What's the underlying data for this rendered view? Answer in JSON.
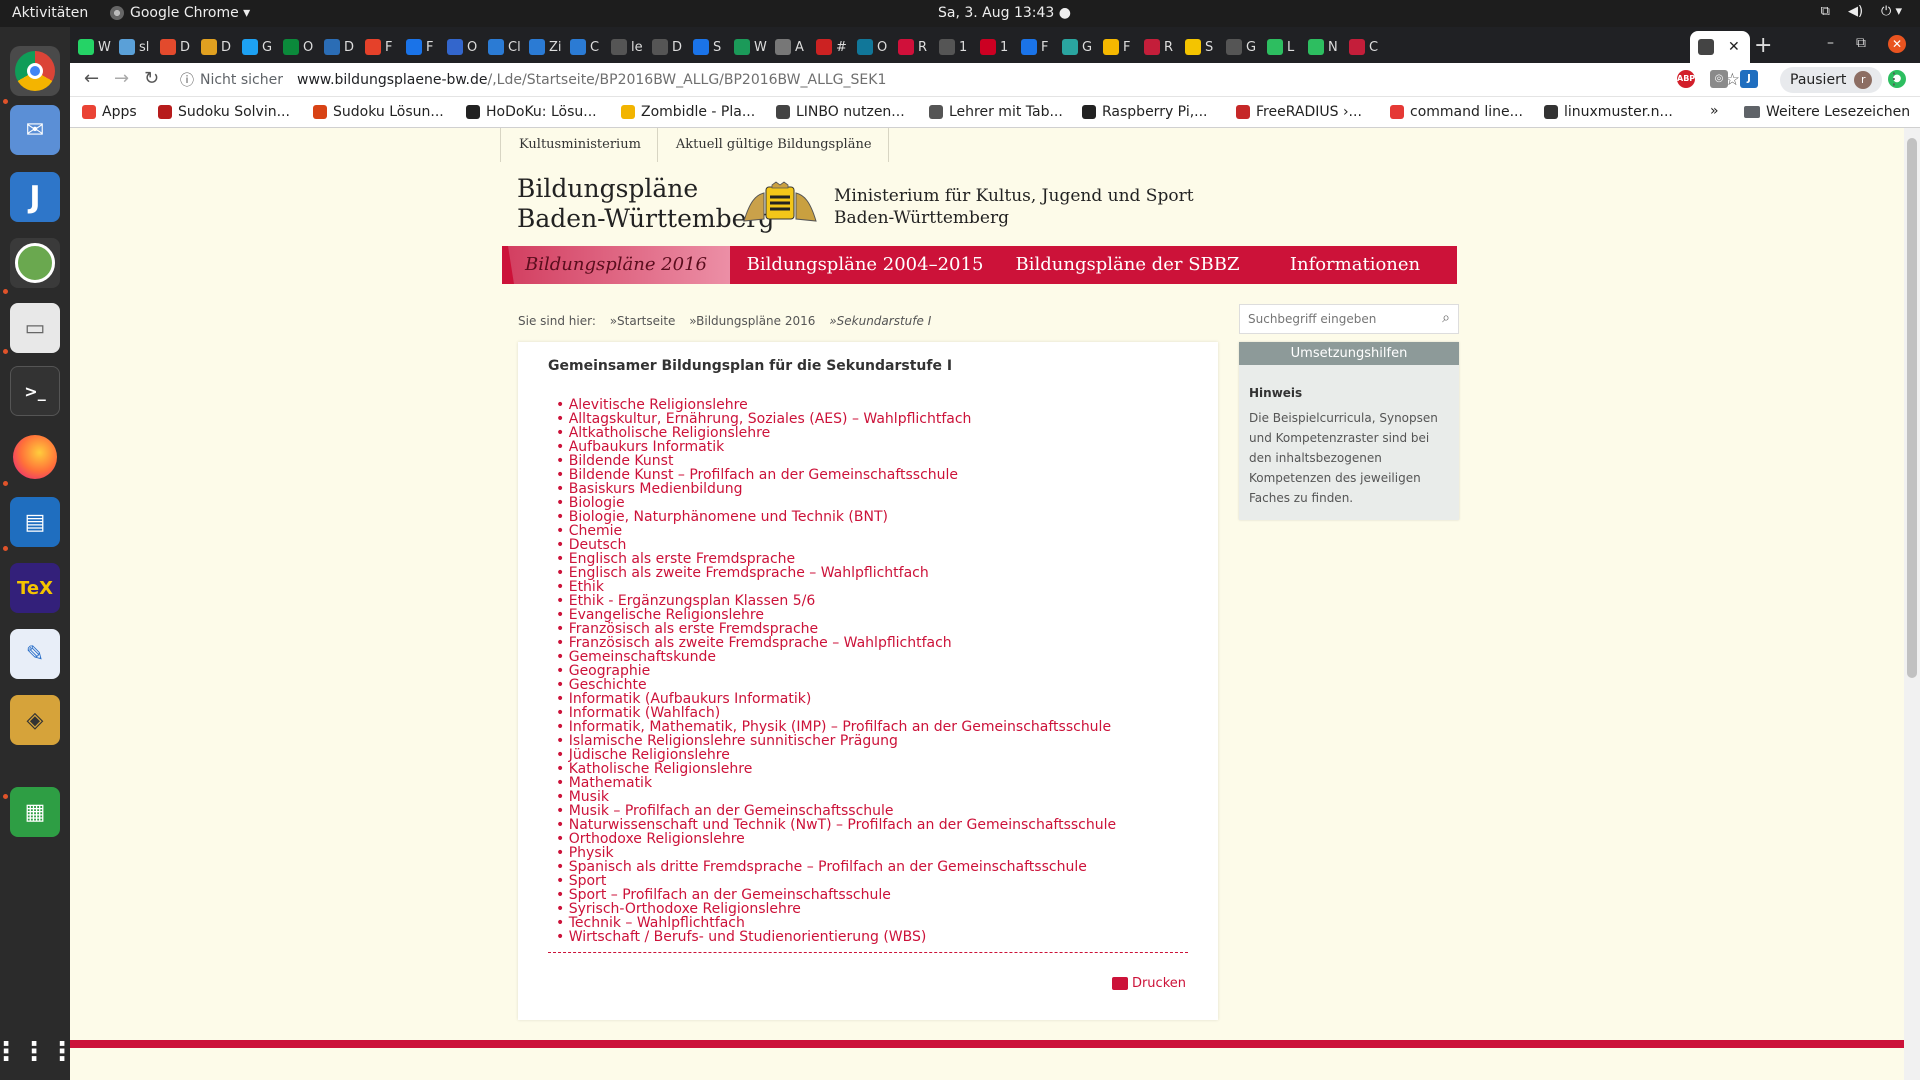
{
  "topbar": {
    "activities": "Aktivitäten",
    "app_name": "Google Chrome ▾",
    "clock": "Sa, 3. Aug  13:43 ●"
  },
  "dock": {
    "apps": [
      "chrome-icon",
      "mail-icon",
      "jabref-icon",
      "keepassx-icon",
      "files-icon",
      "terminal-icon",
      "firefox-icon",
      "writer-icon",
      "texmaker-icon",
      "text-editor-icon",
      "wine-icon",
      "calc-icon"
    ],
    "show_apps": "⋮⋮⋮"
  },
  "tabs": [
    {
      "label": "W",
      "color": "#25d366"
    },
    {
      "label": "sl",
      "color": "#5aa0d8"
    },
    {
      "label": "D",
      "color": "#e34a2d"
    },
    {
      "label": "D",
      "color": "#e0a020"
    },
    {
      "label": "G",
      "color": "#1da1f2"
    },
    {
      "label": "O",
      "color": "#0b8a3b"
    },
    {
      "label": "D",
      "color": "#2b6db5"
    },
    {
      "label": "F",
      "color": "#e5412a"
    },
    {
      "label": "F",
      "color": "#1a73e8"
    },
    {
      "label": "O",
      "color": "#3366cc"
    },
    {
      "label": "Cl",
      "color": "#2b7bd4"
    },
    {
      "label": "Zi",
      "color": "#2b7bd4"
    },
    {
      "label": "C",
      "color": "#2b7bd4"
    },
    {
      "label": "le",
      "color": "#555"
    },
    {
      "label": "D",
      "color": "#555"
    },
    {
      "label": "S",
      "color": "#1a73e8"
    },
    {
      "label": "W",
      "color": "#1b9a59"
    },
    {
      "label": "A",
      "color": "#777"
    },
    {
      "label": "#",
      "color": "#cc2222"
    },
    {
      "label": "O",
      "color": "#117799"
    },
    {
      "label": "R",
      "color": "#d0103a"
    },
    {
      "label": "1",
      "color": "#555"
    },
    {
      "label": "1",
      "color": "#cc0022"
    },
    {
      "label": "F",
      "color": "#1a73e8"
    },
    {
      "label": "G",
      "color": "#2aa5a0"
    },
    {
      "label": "F",
      "color": "#f5b800"
    },
    {
      "label": "R",
      "color": "#c41e3a"
    },
    {
      "label": "S",
      "color": "#f4c400"
    },
    {
      "label": "G",
      "color": "#555"
    },
    {
      "label": "L",
      "color": "#2dbe60"
    },
    {
      "label": "N",
      "color": "#2dbe60"
    },
    {
      "label": "C",
      "color": "#c41e3a"
    }
  ],
  "toolbar": {
    "not_secure": "Nicht sicher",
    "url_host": "www.bildungsplaene-bw.de",
    "url_path": "/,Lde/Startseite/BP2016BW_ALLG/BP2016BW_ALLG_SEK1",
    "profile_label": "Pausiert",
    "profile_initial": "r"
  },
  "bookmarks": {
    "items": [
      {
        "label": "Apps",
        "color": "#ea4335"
      },
      {
        "label": "Sudoku Solvin...",
        "color": "#b71c1c"
      },
      {
        "label": "Sudoku Lösun...",
        "color": "#d84315"
      },
      {
        "label": "HoDoKu: Lösu...",
        "color": "#222222"
      },
      {
        "label": "Zombidle - Pla...",
        "color": "#f2b400"
      },
      {
        "label": "LINBO nutzen...",
        "color": "#444444"
      },
      {
        "label": "Lehrer mit Tab...",
        "color": "#555555"
      },
      {
        "label": "Raspberry Pi,...",
        "color": "#222222"
      },
      {
        "label": "FreeRADIUS ›...",
        "color": "#c62828"
      },
      {
        "label": "command line...",
        "color": "#e53935"
      },
      {
        "label": "linuxmuster.n...",
        "color": "#333333"
      }
    ],
    "more": "»",
    "other": "Weitere Lesezeichen"
  },
  "site": {
    "topnav": [
      "Kultusministerium",
      "Aktuell gültige Bildungspläne"
    ],
    "brand_line1": "Bildungspläne",
    "brand_line2": "Baden-Württemberg",
    "ministry_line1": "Ministerium für Kultus, Jugend und Sport",
    "ministry_line2": "Baden-Württemberg",
    "mainnav": [
      "Bildungspläne 2016",
      "Bildungspläne 2004–2015",
      "Bildungspläne der SBBZ",
      "Informationen"
    ],
    "breadcrumb": {
      "prefix": "Sie sind hier:",
      "items": [
        "»Startseite",
        "»Bildungspläne 2016"
      ],
      "current": "»Sekundarstufe I"
    },
    "content_title": "Gemeinsamer Bildungsplan für die Sekundarstufe I",
    "subjects": [
      "Alevitische Religionslehre",
      "Alltagskultur, Ernährung, Soziales (AES) – Wahlpflichtfach",
      "Altkatholische Religionslehre",
      "Aufbaukurs Informatik",
      "Bildende Kunst",
      "Bildende Kunst – Profilfach an der Gemeinschaftsschule",
      "Basiskurs Medienbildung",
      "Biologie",
      "Biologie, Naturphänomene und Technik (BNT)",
      "Chemie",
      "Deutsch",
      "Englisch als erste Fremdsprache",
      "Englisch als zweite Fremdsprache – Wahlpflichtfach",
      "Ethik",
      "Ethik - Ergänzungsplan Klassen 5/6",
      "Evangelische Religionslehre",
      "Französisch als erste Fremdsprache",
      "Französisch als zweite Fremdsprache – Wahlpflichtfach",
      "Gemeinschaftskunde",
      "Geographie",
      "Geschichte",
      "Informatik (Aufbaukurs Informatik)",
      "Informatik (Wahlfach)",
      "Informatik, Mathematik, Physik (IMP) – Profilfach an der Gemeinschaftsschule",
      "Islamische Religionslehre sunnitischer Prägung",
      "Jüdische Religionslehre",
      "Katholische Religionslehre",
      "Mathematik",
      "Musik",
      "Musik – Profilfach an der Gemeinschaftsschule",
      "Naturwissenschaft und Technik (NwT) – Profilfach an der Gemeinschaftsschule",
      "Orthodoxe Religionslehre",
      "Physik",
      "Spanisch als dritte Fremdsprache – Profilfach an der Gemeinschaftsschule",
      "Sport",
      "Sport – Profilfach an der Gemeinschaftsschule",
      "Syrisch-Orthodoxe Religionslehre",
      "Technik – Wahlpflichtfach",
      "Wirtschaft / Berufs- und Studienorientierung (WBS)"
    ],
    "print_label": "Drucken",
    "search_placeholder": "Suchbegriff eingeben",
    "aside_header": "Umsetzungshilfen",
    "aside_title": "Hinweis",
    "aside_text": "Die Beispielcurricula, Synopsen und Kompetenzraster sind bei den inhaltsbezogenen Kompetenzen des jeweiligen Faches zu finden.",
    "accent_color": "#cc1239"
  }
}
